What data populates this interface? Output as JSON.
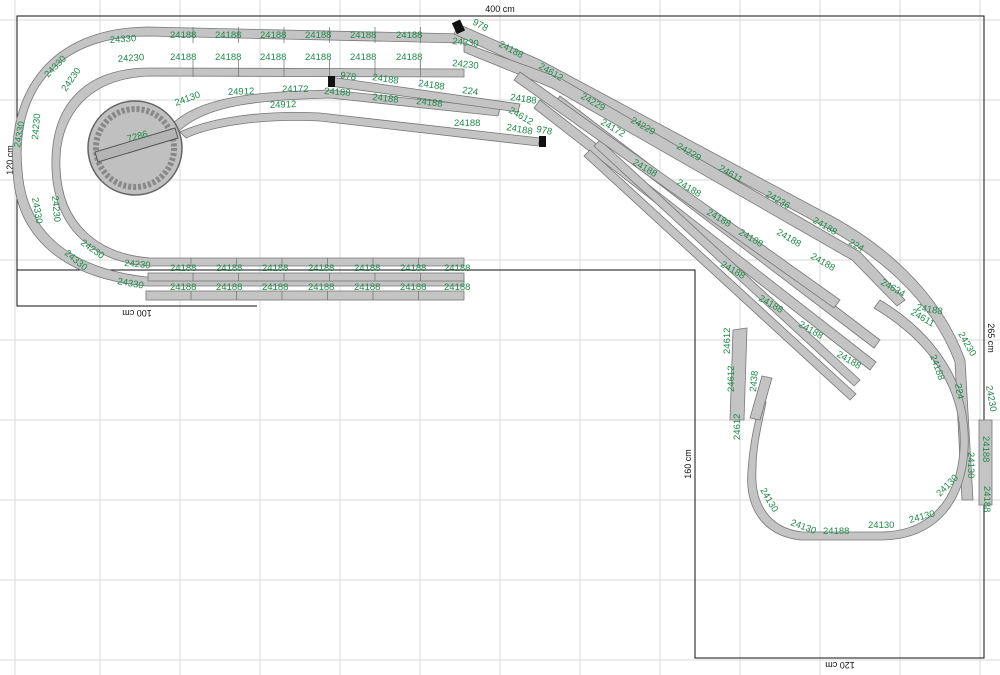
{
  "colors": {
    "grid": "#d9d9d9",
    "track_fill": "#c4c4c4",
    "track_edge": "#777777",
    "label": "#1f8a4c",
    "outline": "#111111",
    "bumper": "#111111"
  },
  "dimensions": {
    "top_width": "400 cm",
    "left_height": "120 cm",
    "bottom_left_width": "100 cm",
    "right_height": "265 cm",
    "inner_height": "160 cm",
    "bottom_right_width": "120 cm"
  },
  "turntable_label": "7286",
  "track_labels": {
    "top_outer": [
      "24330",
      "24188",
      "24188",
      "24188",
      "24188",
      "24188",
      "24188",
      "24330"
    ],
    "top_inner": [
      "24230",
      "24188",
      "24188",
      "24188",
      "24188",
      "24188",
      "24188",
      "24230"
    ],
    "left_outer": [
      "24330",
      "24330",
      "24330",
      "24330"
    ],
    "left_inner": [
      "24230",
      "24230",
      "24230",
      "24230"
    ],
    "bottom_outer": [
      "24330",
      "24188",
      "24188",
      "24188",
      "24188",
      "24188",
      "24188",
      "24188"
    ],
    "bottom_inner": [
      "24230",
      "24188",
      "24188",
      "24188",
      "24188",
      "24188",
      "24188",
      "24188"
    ],
    "yard_upper": [
      "978",
      "24188",
      "24188",
      "224",
      "24188"
    ],
    "yard_lower": [
      "24130",
      "24912",
      "24912",
      "24172",
      "24188",
      "24188",
      "24188",
      "24188",
      "24612",
      "24188",
      "978"
    ],
    "diagonal": [
      "978",
      "24188",
      "24612",
      "24229",
      "24229",
      "24229",
      "24611",
      "24236",
      "24188",
      "224",
      "24634",
      "24611"
    ],
    "diagonal_yard": [
      "24172",
      "24188",
      "24188",
      "24188",
      "24188",
      "24188",
      "24188",
      "24188",
      "24188",
      "24188",
      "24188"
    ],
    "right_curve": [
      "24188",
      "24230",
      "24188",
      "24230",
      "224",
      "24188",
      "24130",
      "24188"
    ],
    "bottom_loop": [
      "24130",
      "24130",
      "24188",
      "24130",
      "24130",
      "24130"
    ],
    "siding": [
      "24612",
      "24612",
      "24612",
      "2438"
    ]
  }
}
